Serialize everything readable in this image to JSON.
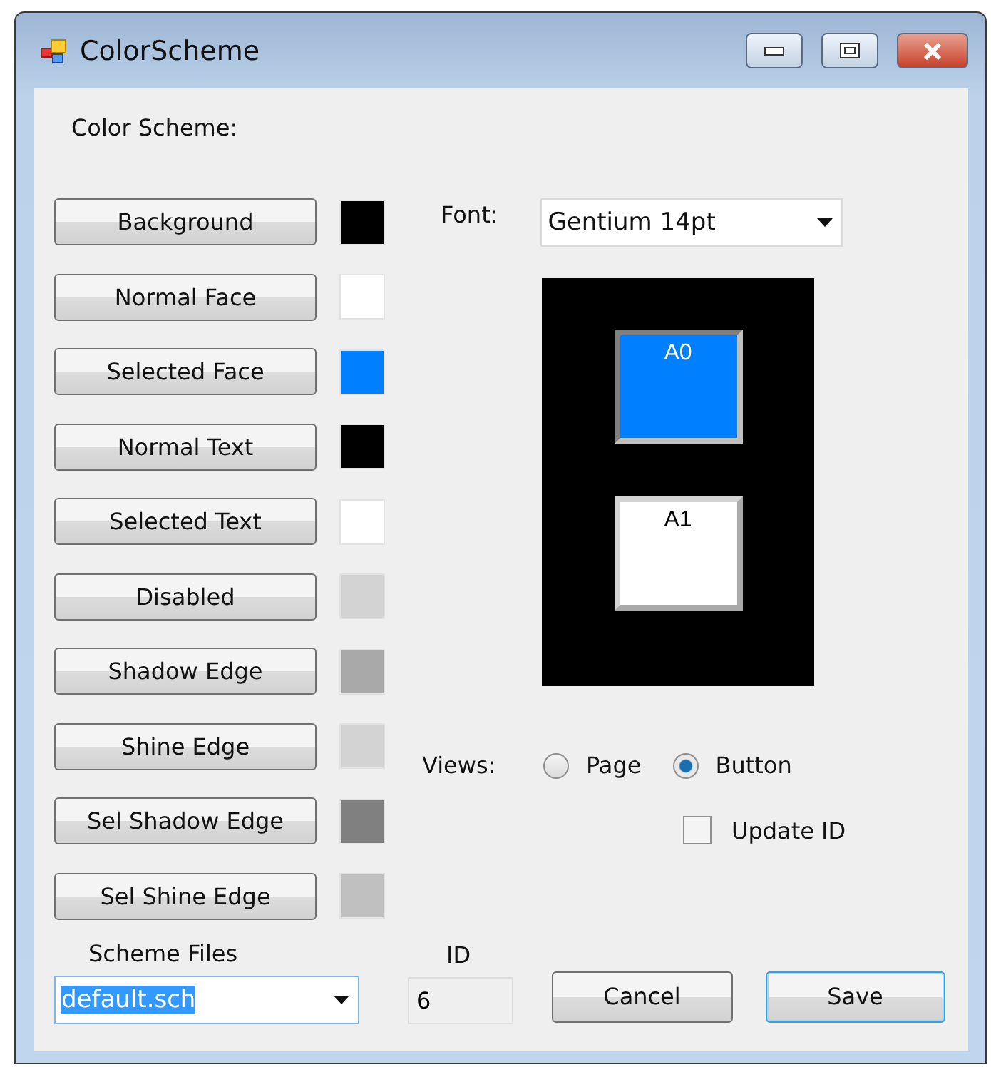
{
  "window": {
    "title": "ColorScheme"
  },
  "heading": "Color Scheme:",
  "scheme_items": [
    {
      "label": "Background",
      "color": "#000000"
    },
    {
      "label": "Normal Face",
      "color": "#ffffff"
    },
    {
      "label": "Selected Face",
      "color": "#0080ff"
    },
    {
      "label": "Normal Text",
      "color": "#000000"
    },
    {
      "label": "Selected Text",
      "color": "#ffffff"
    },
    {
      "label": "Disabled",
      "color": "#d3d3d3"
    },
    {
      "label": "Shadow Edge",
      "color": "#a9a9a9"
    },
    {
      "label": "Shine Edge",
      "color": "#d3d3d3"
    },
    {
      "label": "Sel Shadow Edge",
      "color": "#808080"
    },
    {
      "label": "Sel Shine Edge",
      "color": "#c0c0c0"
    }
  ],
  "font": {
    "label": "Font:",
    "value": "Gentium 14pt"
  },
  "preview": {
    "buttons": [
      {
        "label": "A0",
        "selected": true
      },
      {
        "label": "A1",
        "selected": false
      }
    ]
  },
  "views": {
    "label": "Views:",
    "options": [
      {
        "label": "Page",
        "selected": false
      },
      {
        "label": "Button",
        "selected": true
      }
    ]
  },
  "update_id": {
    "label": "Update ID",
    "checked": false
  },
  "scheme_files": {
    "label": "Scheme Files",
    "value": "default.sch"
  },
  "id": {
    "label": "ID",
    "value": "6"
  },
  "buttons": [
    {
      "label": "Cancel",
      "kind": "normal"
    },
    {
      "label": "Save",
      "kind": "default"
    }
  ]
}
